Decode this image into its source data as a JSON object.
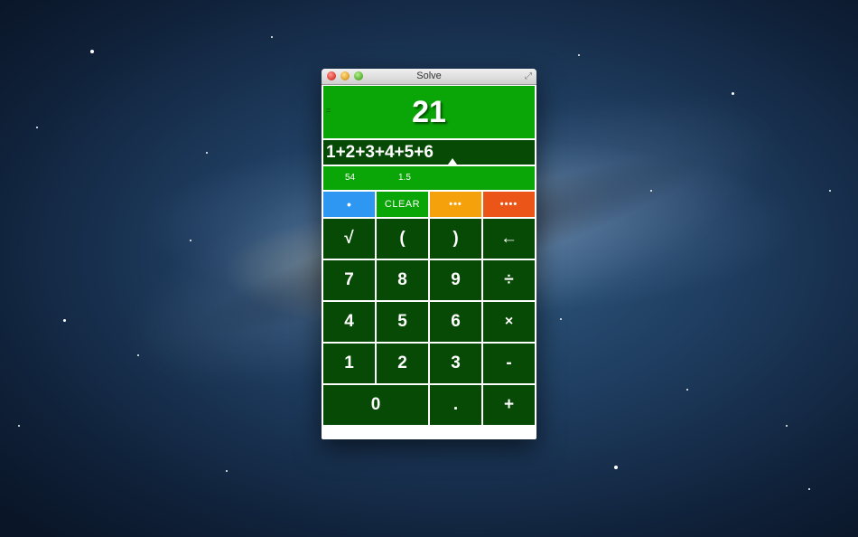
{
  "window": {
    "title": "Solve"
  },
  "display": {
    "equals_symbol": "=",
    "result": "21",
    "expression": "1+2+3+4+5+6",
    "history": [
      "54",
      "1.5"
    ]
  },
  "modes": {
    "blue": "•",
    "clear": "CLEAR",
    "orange": "•••",
    "red": "••••"
  },
  "keypad": {
    "sqrt": "√",
    "lparen": "(",
    "rparen": ")",
    "backspace": "←",
    "d7": "7",
    "d8": "8",
    "d9": "9",
    "divide": "÷",
    "d4": "4",
    "d5": "5",
    "d6": "6",
    "multiply": "×",
    "d1": "1",
    "d2": "2",
    "d3": "3",
    "minus": "-",
    "d0": "0",
    "decimal": ".",
    "plus": "+"
  },
  "pager": {
    "count": 5,
    "active_index": 2
  },
  "colors": {
    "bright_green": "#0aa507",
    "dark_green": "#074a05",
    "mode_blue": "#2e97f2",
    "mode_orange": "#f5a10b",
    "mode_red": "#eb5518"
  }
}
